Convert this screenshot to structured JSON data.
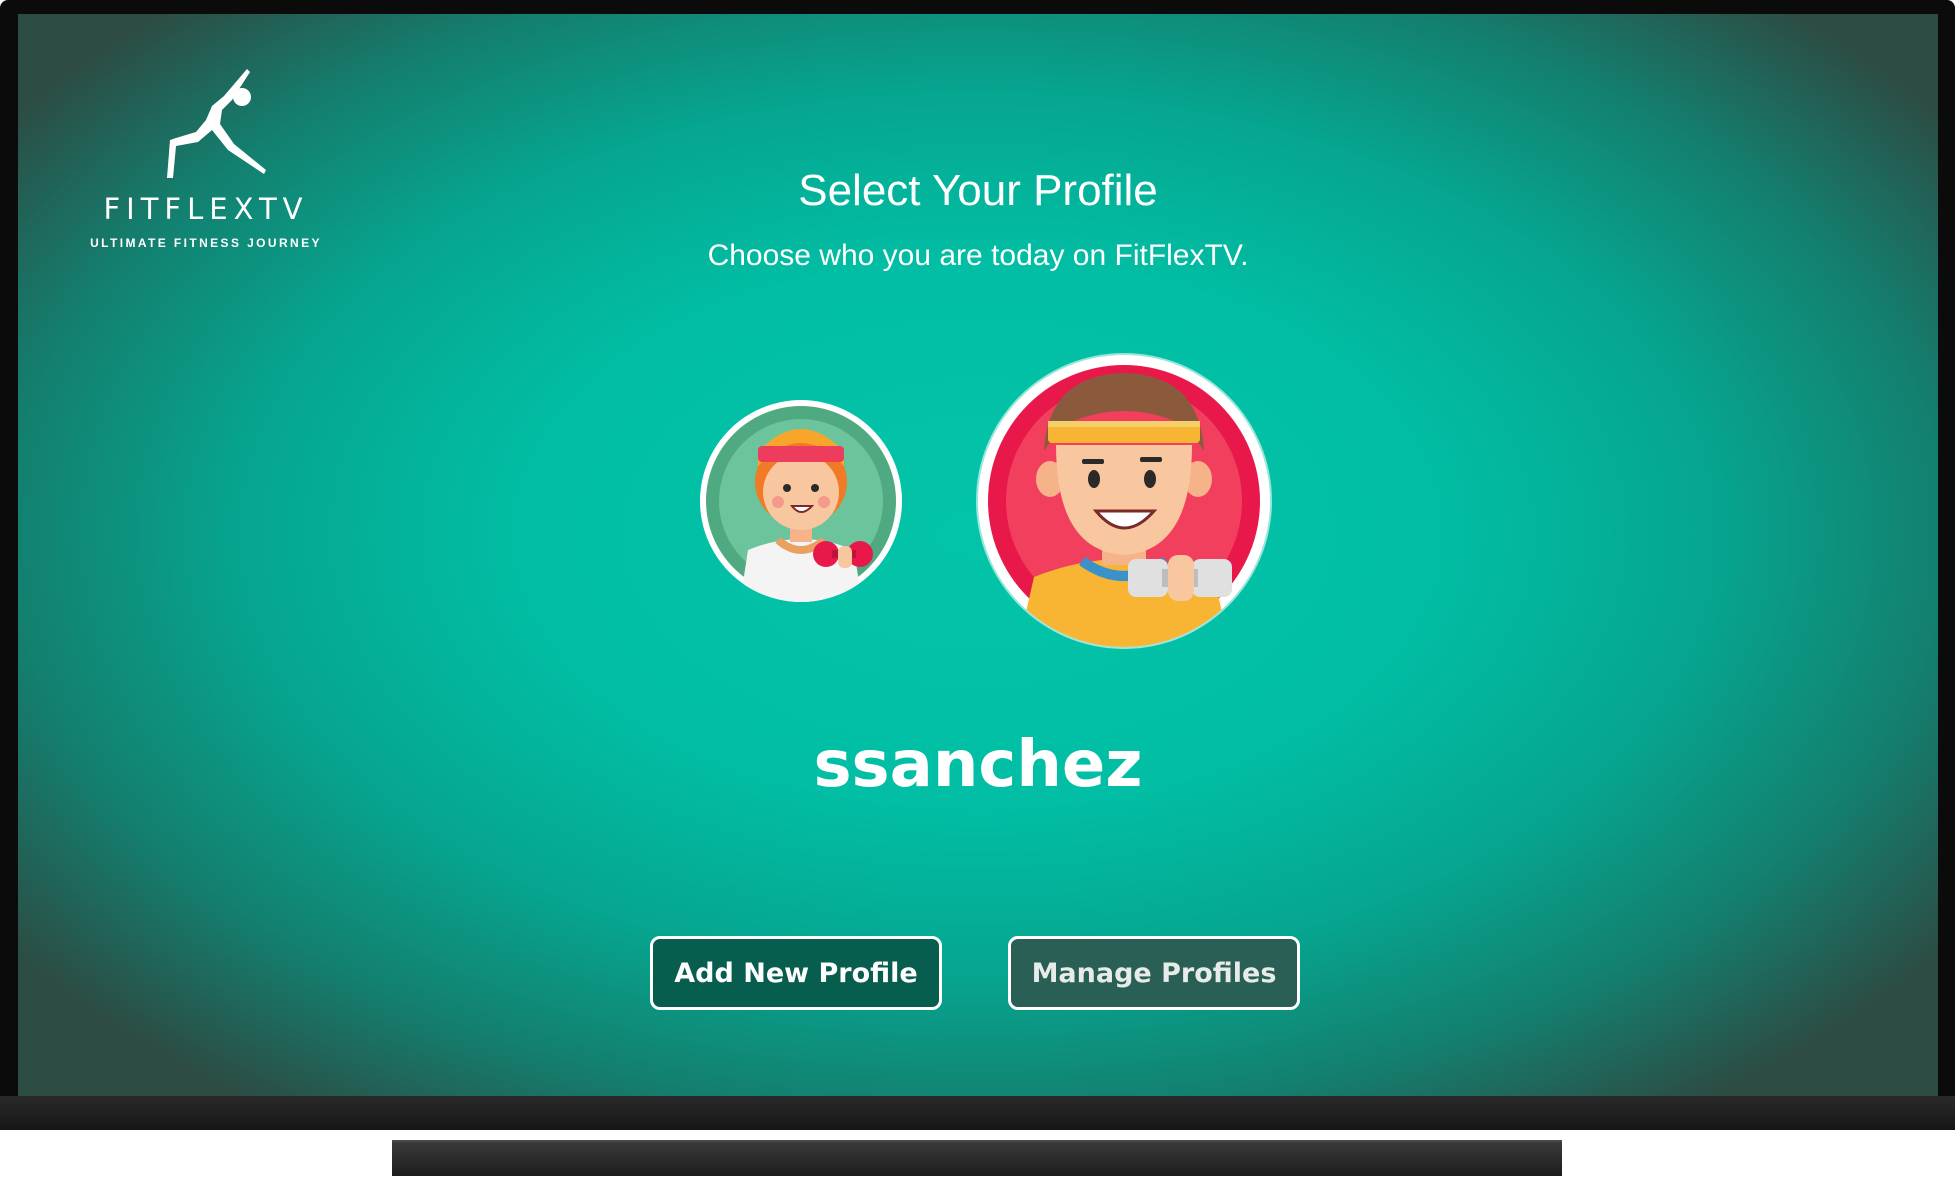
{
  "app": {
    "logo_name": "FITFLEXTV",
    "logo_tagline": "ULTIMATE FITNESS JOURNEY"
  },
  "header": {
    "title": "Select Your Profile",
    "subtitle": "Choose who you are today on FitFlexTV."
  },
  "profiles": [
    {
      "id": "profile-woman",
      "selected": false,
      "icon": "woman-with-dumbbell-avatar",
      "bg_color": "#5fb88f"
    },
    {
      "id": "profile-man",
      "selected": true,
      "icon": "man-with-dumbbell-avatar",
      "bg_color": "#e8194a"
    }
  ],
  "selected_profile_name": "ssanchez",
  "actions": {
    "add_label": "Add New Profile",
    "manage_label": "Manage Profiles"
  },
  "colors": {
    "screen_bg": "#01bea4",
    "add_button_bg": "#075e4e",
    "manage_button_bg": "#2a5f55"
  }
}
